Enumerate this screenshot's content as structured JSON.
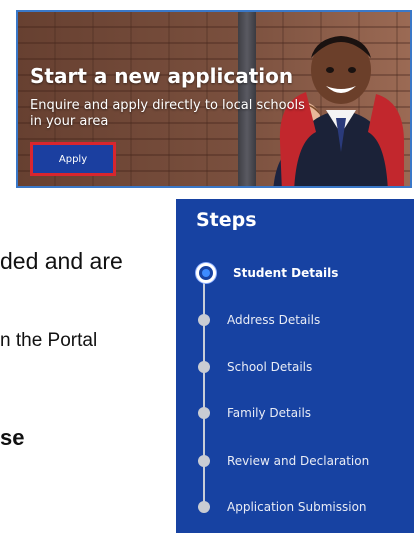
{
  "hero": {
    "title": "Start a new application",
    "subtitle": "Enquire and apply directly to local schools in your area",
    "apply_label": "Apply"
  },
  "slide": {
    "line1": "ded and are",
    "line2": "n the Portal",
    "line3": "se"
  },
  "steps": {
    "title": "Steps",
    "items": [
      {
        "label": "Student Details",
        "active": true
      },
      {
        "label": "Address Details",
        "active": false
      },
      {
        "label": "School Details",
        "active": false
      },
      {
        "label": "Family Details",
        "active": false
      },
      {
        "label": "Review and Declaration",
        "active": false
      },
      {
        "label": "Application Submission",
        "active": false
      }
    ]
  },
  "colors": {
    "panel_blue": "#1742a2",
    "button_blue": "#1b3fa0",
    "button_border": "#d8262e"
  }
}
